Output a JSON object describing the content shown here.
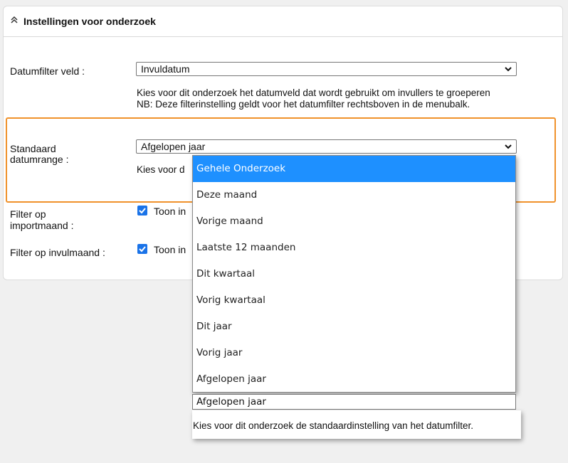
{
  "panel": {
    "title": "Instellingen voor onderzoek",
    "collapse_icon": "double-chevron-up-icon"
  },
  "datumfilter": {
    "label": "Datumfilter veld :",
    "value": "Invuldatum",
    "help_line1": "Kies voor dit onderzoek het datumveld dat wordt gebruikt om invullers te groeperen",
    "help_line2": "NB: Deze filterinstelling geldt voor het datumfilter rechtsboven in de menubalk."
  },
  "datumrange": {
    "label_line1": "Standaard",
    "label_line2": "datumrange :",
    "value": "Afgelopen jaar",
    "help": "Kies voor d"
  },
  "importmaand": {
    "label_line1": "Filter op",
    "label_line2": "importmaand :",
    "checked": true,
    "text": "Toon in"
  },
  "invulmaand": {
    "label": "Filter op invulmaand :",
    "checked": true,
    "text": "Toon in"
  },
  "dropdown": {
    "options": [
      {
        "label": "Gehele Onderzoek",
        "selected": true
      },
      {
        "label": "Deze maand",
        "selected": false
      },
      {
        "label": "Vorige maand",
        "selected": false
      },
      {
        "label": "Laatste 12 maanden",
        "selected": false
      },
      {
        "label": "Dit kwartaal",
        "selected": false
      },
      {
        "label": "Vorig kwartaal",
        "selected": false
      },
      {
        "label": "Dit jaar",
        "selected": false
      },
      {
        "label": "Vorig jaar",
        "selected": false
      },
      {
        "label": "Afgelopen jaar",
        "selected": false
      }
    ],
    "ghost_value": "Afgelopen jaar",
    "ghost_help": "Kies voor dit onderzoek de standaardinstelling van het datumfilter."
  },
  "colors": {
    "focus_border": "#f0922b",
    "selected_option": "#1e90ff",
    "checkbox": "#1a73e8"
  }
}
